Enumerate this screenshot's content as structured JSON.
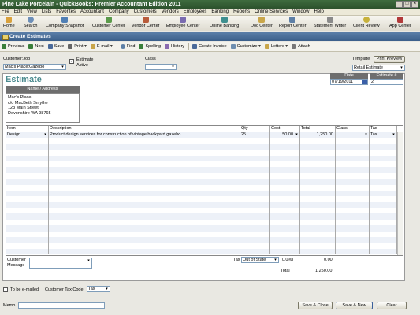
{
  "window": {
    "title": "Pine Lake Porcelain - QuickBooks: Premier Accountant Edition 2011",
    "btn_min": "_",
    "btn_max": "□",
    "btn_close": "×"
  },
  "menu": [
    "File",
    "Edit",
    "View",
    "Lists",
    "Favorites",
    "Accountant",
    "Company",
    "Customers",
    "Vendors",
    "Employees",
    "Banking",
    "Reports",
    "Online Services",
    "Window",
    "Help"
  ],
  "nav": {
    "home": "Home",
    "search": "Search",
    "snapshot": "Company Snapshot",
    "customer_center": "Customer Center",
    "vendor_center": "Vendor Center",
    "employee_center": "Employee Center",
    "online_banking": "Online Banking",
    "doc_center": "Doc Center",
    "report_center": "Report Center",
    "statement_writer": "Statement Writer",
    "client_review": "Client Review",
    "app_center": "App Center"
  },
  "form": {
    "title": "Create Estimates"
  },
  "toolbar": {
    "previous": "Previous",
    "next": "Next",
    "save": "Save",
    "print": "Print",
    "email": "E-mail",
    "find": "Find",
    "spelling": "Spelling",
    "history": "History",
    "create_invoice": "Create Invoice",
    "customize": "Customize",
    "letters": "Letters",
    "attach": "Attach"
  },
  "header": {
    "customer_job_label": "Customer:Job",
    "customer_job_value": "Mac's Place:Gazebo",
    "estimate_active_label": "Estimate Active",
    "estimate_active_checked": "✓",
    "class_label": "Class",
    "class_value": "",
    "template_label": "Template",
    "print_preview": "Print Preview",
    "template_value": "Retail Estimate"
  },
  "estimate": {
    "title": "Estimate",
    "date_label": "Date",
    "date_value": "07/19/2011",
    "number_label": "Estimate #",
    "number_value": "2",
    "address_label": "Name / Address",
    "address_lines": [
      "Mac's Place",
      "c/o MacBeth Smythe",
      "123 Main Street",
      "Devonshire WA 98765"
    ]
  },
  "grid": {
    "columns": {
      "item": "Item",
      "description": "Description",
      "qty": "Qty",
      "cost": "Cost",
      "total": "Total",
      "class": "Class",
      "tax": "Tax"
    },
    "row1": {
      "item": "Design",
      "description": "Product design services for construction of vintage backyard gazebo",
      "qty": "25",
      "cost": "50.00",
      "total": "1,250.00",
      "class": "",
      "tax": "Tax"
    }
  },
  "footer": {
    "customer_message_label": "Customer Message",
    "tax_label": "Tax",
    "tax_value": "Out of State",
    "tax_rate": "(0.0%)",
    "tax_amount": "0.00",
    "total_label": "Total",
    "total_value": "1,250.00",
    "to_be_emailed": "To be e-mailed",
    "customer_tax_code_label": "Customer Tax Code",
    "customer_tax_code_value": "Tax",
    "memo_label": "Memo",
    "save_close": "Save & Close",
    "save_new": "Save & New",
    "clear": "Clear"
  },
  "colors": {
    "titlebar": "#2c512c",
    "form_title": "#3b5f8a",
    "estimate_title": "#4a8a8e",
    "row_alt": "#edf1f8"
  }
}
